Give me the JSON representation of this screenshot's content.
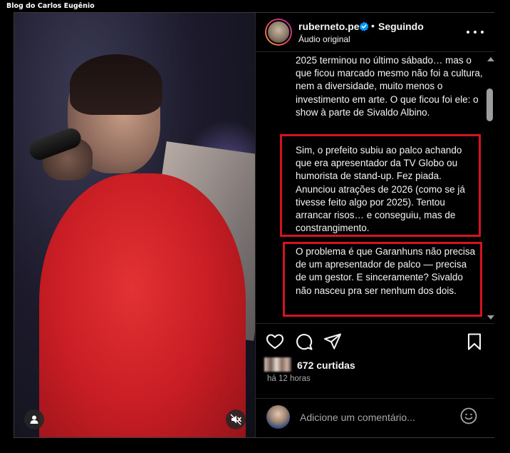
{
  "watermark": "Blog do Carlos Eugênio",
  "header": {
    "username": "ruberneto.pe",
    "separator": "•",
    "follow_status": "Seguindo",
    "audio_label": "Áudio original"
  },
  "caption": {
    "paragraph_1": "2025 terminou no último sábado… mas o que ficou marcado mesmo não foi a cultura, nem a diversidade, muito menos o investimento em arte. O que ficou foi ele: o show à parte de Sivaldo Albino.",
    "paragraph_2": "Sim, o prefeito subiu ao palco achando que era apresentador da TV Globo ou humorista de stand-up. Fez piada. Anunciou atrações de 2026 (como se já tivesse feito algo por 2025). Tentou arrancar risos… e conseguiu, mas de constrangimento.",
    "paragraph_3": "O problema é que Garanhuns não precisa de um apresentador de palco — precisa de um gestor. E sinceramente? Sivaldo não nasceu pra ser nenhum dos dois."
  },
  "highlight_color": "#d3131f",
  "stats": {
    "likes": "672 curtidas",
    "time_ago": "há 12 horas"
  },
  "comment_box": {
    "placeholder": "Adicione um comentário..."
  },
  "icons": {
    "verified": "verified-badge-icon",
    "more": "more-options-icon",
    "like": "heart-icon",
    "comment": "comment-bubble-icon",
    "share": "paper-plane-icon",
    "save": "bookmark-icon",
    "emoji": "smiley-icon",
    "tagged_user": "user-icon",
    "mute": "muted-speaker-icon"
  }
}
